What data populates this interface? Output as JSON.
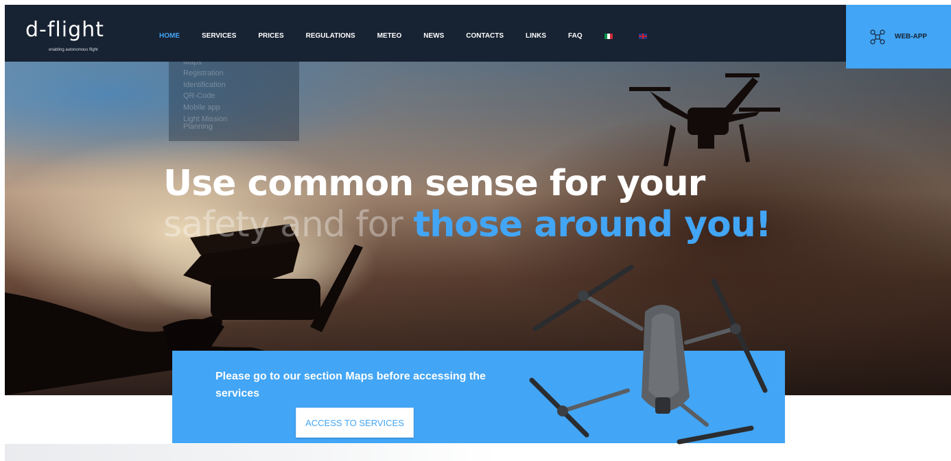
{
  "brand": {
    "logo_text": "d-flight",
    "tagline": "enabling autonomous flight",
    "accent_red": "#e53935"
  },
  "nav": {
    "items": [
      {
        "label": "HOME",
        "active": true
      },
      {
        "label": "SERVICES",
        "active": false
      },
      {
        "label": "PRICES",
        "active": false
      },
      {
        "label": "REGULATIONS",
        "active": false
      },
      {
        "label": "METEO",
        "active": false
      },
      {
        "label": "NEWS",
        "active": false
      },
      {
        "label": "CONTACTS",
        "active": false
      },
      {
        "label": "LINKS",
        "active": false
      },
      {
        "label": "FAQ",
        "active": false
      }
    ],
    "languages": [
      "italian-flag-icon",
      "uk-flag-icon"
    ],
    "background": "#172232",
    "active_color": "#42a5f5"
  },
  "webapp": {
    "label": "WEB-APP",
    "icon": "drone-icon",
    "background": "#42a5f5"
  },
  "services_submenu": {
    "items": [
      "Maps",
      "Registration",
      "Identification",
      "QR-Code",
      "Mobile app",
      "Light Mission",
      "Planning"
    ]
  },
  "hero": {
    "line1": "Use common sense for your",
    "line2_light": "safety and for ",
    "line2_highlight": "those around you!"
  },
  "cta": {
    "message": "Please go to our section Maps before accessing the services",
    "button_label": "ACCESS TO SERVICES",
    "background": "#42a5f5"
  }
}
